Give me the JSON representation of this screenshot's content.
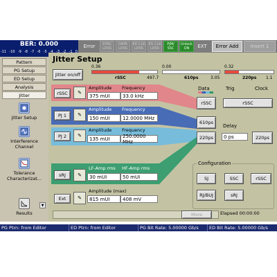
{
  "ber": {
    "title": "BER: 0.000",
    "scale": [
      "-11",
      "-10",
      "-9",
      "-8",
      "-7",
      "-6",
      "-5",
      "-4",
      "-3",
      "-2",
      "-1",
      "0"
    ]
  },
  "status": {
    "error": "Error",
    "sync_loss": "SYNC LOSS",
    "data_loss": "DATA LOSS",
    "ed_clk_loss": "ED CLK LOSS",
    "pg_clk_loss": "PG CLK LOSS",
    "pjm_ssc": "PJM/ SSC",
    "unlock": "Unlock ON",
    "ext": "EXT",
    "error_add": "Error Add",
    "insert": "Insert 1"
  },
  "sidebar": {
    "tabs": [
      "Pattern",
      "PG Setup",
      "ED Setup",
      "Analysis",
      "Jitter"
    ],
    "tools": [
      "Jitter Setup",
      "Interference Channel",
      "Tolerance Characterizat...",
      "Results"
    ]
  },
  "main": {
    "title": "Jitter Setup",
    "jitter_onoff": "Jitter on/off",
    "meters": [
      {
        "value": "0.36",
        "label": "rSSC",
        "max": "497.7",
        "fill": 0.72
      },
      {
        "value": "0.00",
        "label": "610ps",
        "max": "3.05",
        "fill": 0.0
      },
      {
        "value": "0.32",
        "label": "220ps",
        "max": "1.1",
        "fill": 0.29
      }
    ],
    "rows": [
      {
        "button": "rSSC",
        "h1": "Amplitude",
        "h2": "Frequency",
        "v1": "375 mUI",
        "v2": "33.0 kHz",
        "color": "#e67b86"
      },
      {
        "button": "PJ 1",
        "h1": "Amplitude",
        "h2": "Frequency",
        "v1": "150 mUI",
        "v2": "12.0000 MHz",
        "color": "#3b63b8"
      },
      {
        "button": "PJ 2",
        "h1": "Amplitude",
        "h2": "Frequency",
        "v1": "135 mUI",
        "v2": "250.0000 MHz",
        "color": "#6fbbe0"
      },
      {
        "button": "sRJ",
        "h1": "LF-Amp rms",
        "h2": "HF-Amp rms",
        "v1": "30 mUI",
        "v2": "50 mUI",
        "color": "#2e9a6c"
      },
      {
        "button": "Ext",
        "h1": "Amplitude (max)",
        "h2": "",
        "v1": "815 mUI",
        "v2": "408 mV",
        "color": "#c3c3a4"
      }
    ],
    "data_label": "Data",
    "trig_label": "Trig",
    "clock_label": "Clock",
    "data_rssc": "rSSC",
    "trig_rssc": "rSSC",
    "node_610": "610ps",
    "node_220": "220ps",
    "delay_label": "Delay",
    "delay_value": "0 ps",
    "clock_220": "220ps",
    "config_label": "Configuration",
    "config_buttons": [
      "SJ",
      "SSC",
      "rSSC",
      "RJ/BUJ",
      "sRJ"
    ],
    "more": "More",
    "elapsed": "Elapsed 00:00:00"
  },
  "footer": [
    "PG Ptrn: from Editor",
    "ED Ptrn: from Editor",
    "PG Bit Rate: 5.00000 Gb/s",
    "ED Bit Rate: 5.00000 Gb/s"
  ],
  "colors": {
    "row_rssc": "#e67b86",
    "row_pj1": "#3b63b8",
    "row_pj2": "#6fbbe0",
    "row_srj": "#2e9a6c",
    "ber_bg": "#0a1e6e"
  }
}
